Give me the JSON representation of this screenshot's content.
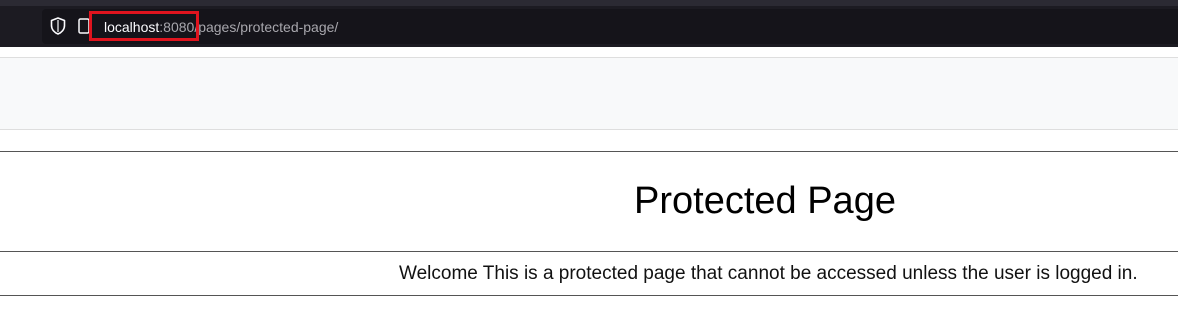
{
  "browser": {
    "address_bar": {
      "host": "localhost",
      "port": ":8080",
      "path": "/pages/protected-page/"
    },
    "icons": [
      "shield-icon",
      "page-icon"
    ],
    "highlight_color": "#e0141e"
  },
  "page": {
    "title": "Protected Page",
    "message": "Welcome This is a protected page that cannot be accessed unless the user is logged in."
  }
}
